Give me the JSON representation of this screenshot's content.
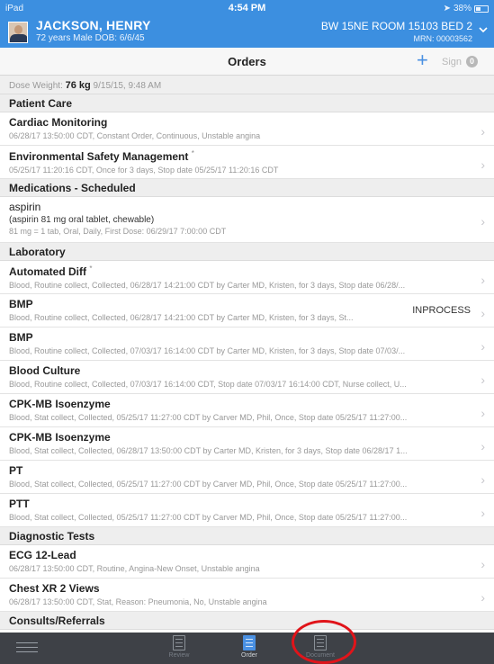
{
  "status_bar": {
    "device": "iPad",
    "time": "4:54 PM",
    "battery": "38%"
  },
  "patient": {
    "name": "JACKSON, HENRY",
    "demographics": "72 years  Male  DOB: 6/6/45",
    "location": "BW 15NE ROOM 15103 BED 2",
    "mrn": "MRN: 00003562"
  },
  "orders_bar": {
    "title": "Orders",
    "add_label": "+",
    "sign_label": "Sign",
    "sign_count": "0"
  },
  "dose": {
    "label": "Dose Weight:",
    "value": "76 kg",
    "timestamp": "9/15/15, 9:48 AM"
  },
  "sections": {
    "patient_care": "Patient Care",
    "meds_scheduled": "Medications - Scheduled",
    "laboratory": "Laboratory",
    "diagnostic": "Diagnostic Tests",
    "consults": "Consults/Referrals"
  },
  "orders": {
    "cardiac": {
      "name": "Cardiac Monitoring",
      "detail": "06/28/17 13:50:00 CDT, Constant Order, Continuous, Unstable angina"
    },
    "env_safety": {
      "name": "Environmental Safety Management",
      "mark": "*",
      "detail": "05/25/17 11:20:16 CDT, Once for 3 days, Stop date 05/25/17 11:20:16 CDT"
    },
    "aspirin": {
      "name": "aspirin",
      "sub": "(aspirin 81 mg oral tablet, chewable)",
      "detail": "81 mg = 1 tab, Oral, Daily, First Dose: 06/29/17 7:00:00 CDT"
    },
    "auto_diff": {
      "name": "Automated Diff",
      "mark": "*",
      "detail": "Blood, Routine collect, Collected, 06/28/17 14:21:00 CDT by Carter MD, Kristen, for 3 days, Stop date 06/28/..."
    },
    "bmp1": {
      "name": "BMP",
      "badge": "INPROCESS",
      "detail": "Blood, Routine collect, Collected, 06/28/17 14:21:00 CDT by Carter MD, Kristen, for 3 days, St..."
    },
    "bmp2": {
      "name": "BMP",
      "detail": "Blood, Routine collect, Collected, 07/03/17 16:14:00 CDT by Carter MD, Kristen, for 3 days, Stop date 07/03/..."
    },
    "blood_culture": {
      "name": "Blood Culture",
      "detail": "Blood, Routine collect, Collected, 07/03/17 16:14:00 CDT, Stop date 07/03/17 16:14:00 CDT, Nurse collect, U..."
    },
    "cpk1": {
      "name": "CPK-MB Isoenzyme",
      "detail": "Blood, Stat collect, Collected, 05/25/17 11:27:00 CDT by Carver MD, Phil, Once, Stop date 05/25/17 11:27:00..."
    },
    "cpk2": {
      "name": "CPK-MB Isoenzyme",
      "detail": "Blood, Stat collect, Collected, 06/28/17 13:50:00 CDT by Carter MD, Kristen, for 3 days, Stop date 06/28/17 1..."
    },
    "pt": {
      "name": "PT",
      "detail": "Blood, Stat collect, Collected, 05/25/17 11:27:00 CDT by Carver MD, Phil, Once, Stop date 05/25/17 11:27:00..."
    },
    "ptt": {
      "name": "PTT",
      "detail": "Blood, Stat collect, Collected, 05/25/17 11:27:00 CDT by Carver MD, Phil, Once, Stop date 05/25/17 11:27:00..."
    },
    "ecg": {
      "name": "ECG 12-Lead",
      "detail": "06/28/17 13:50:00 CDT, Routine, Angina-New Onset, Unstable angina"
    },
    "chest_xr": {
      "name": "Chest XR 2 Views",
      "detail": "06/28/17 13:50:00 CDT, Stat, Reason: Pneumonia, No, Unstable angina"
    }
  },
  "tabbar": {
    "review": "Review",
    "order": "Order",
    "document": "Document"
  },
  "colors": {
    "header_blue": "#3c8fe0",
    "accent": "#4a90e2",
    "tabbar": "#3e4147",
    "highlight": "#e0141a"
  },
  "icons": {
    "menu": "hamburger-icon",
    "review": "document-icon",
    "order": "order-icon",
    "document": "document-icon",
    "add": "plus-icon",
    "chevron": "chevron-right-icon"
  }
}
